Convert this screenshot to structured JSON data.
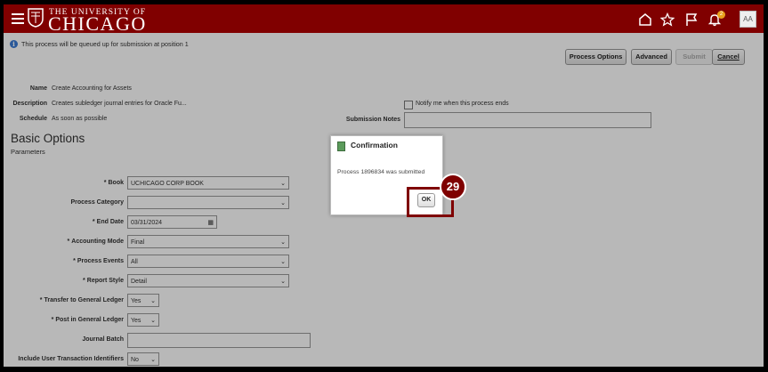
{
  "header": {
    "logo_top": "THE UNIVERSITY OF",
    "logo_main": "CHICAGO",
    "avatar_initials": "AA",
    "notification_count": "2",
    "brand_color": "#800000"
  },
  "info_message": "This process will be queued up for submission at position 1",
  "toolbar": {
    "process_options_label": "Process Options",
    "advanced_label": "Advanced",
    "submit_label": "Submit",
    "cancel_label": "Cancel"
  },
  "summary": {
    "name_label": "Name",
    "name_value": "Create Accounting for Assets",
    "description_label": "Description",
    "description_value": "Creates subledger journal entries for Oracle Fu...",
    "schedule_label": "Schedule",
    "schedule_value": "As soon as possible",
    "notify_label": "Notify me when this process ends",
    "submission_notes_label": "Submission Notes"
  },
  "basic_options": {
    "title": "Basic Options",
    "subtitle": "Parameters",
    "fields": {
      "book": {
        "label": "Book",
        "value": "UCHICAGO CORP BOOK"
      },
      "process_category": {
        "label": "Process Category",
        "value": ""
      },
      "end_date": {
        "label": "End Date",
        "value": "03/31/2024"
      },
      "accounting_mode": {
        "label": "Accounting Mode",
        "value": "Final"
      },
      "process_events": {
        "label": "Process Events",
        "value": "All"
      },
      "report_style": {
        "label": "Report Style",
        "value": "Detail"
      },
      "transfer_gl": {
        "label": "Transfer to General Ledger",
        "value": "Yes"
      },
      "post_gl": {
        "label": "Post in General Ledger",
        "value": "Yes"
      },
      "journal_batch": {
        "label": "Journal Batch",
        "value": ""
      },
      "include_user_txn": {
        "label": "Include User Transaction Identifiers",
        "value": "No"
      }
    }
  },
  "dialog": {
    "title": "Confirmation",
    "message": "Process 1896834 was submitted",
    "ok_label": "OK"
  },
  "step_number": "29"
}
